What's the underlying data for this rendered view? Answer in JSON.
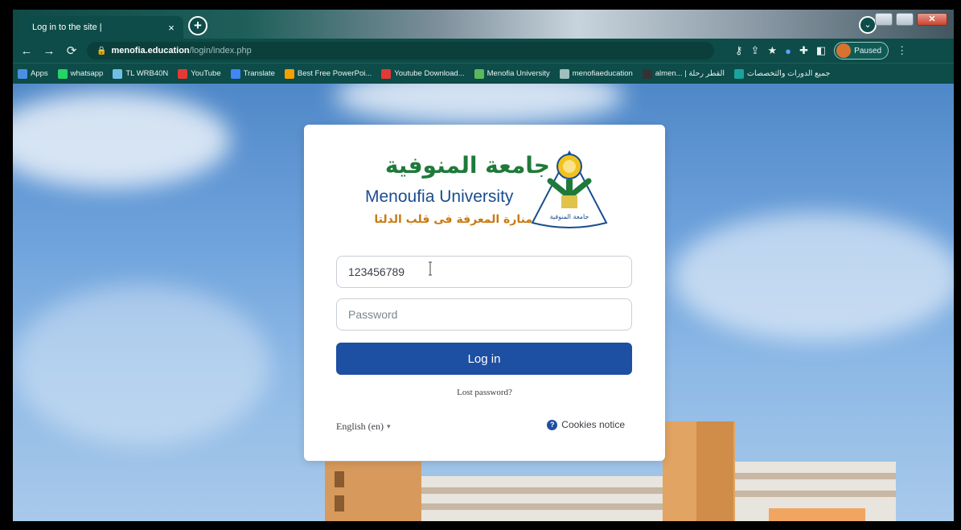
{
  "browser": {
    "tab_title": "Log in to the site |",
    "tab_close": "×",
    "new_tab": "+",
    "url_domain": "menofia.education",
    "url_path": "/login/index.php",
    "profile_label": "Paused",
    "bookmarks": [
      {
        "label": "Apps",
        "icon": "apps-grid-icon",
        "color": "#4a90e2"
      },
      {
        "label": "whatsapp",
        "icon": "whatsapp-icon",
        "color": "#25d366"
      },
      {
        "label": "TL WRB40N",
        "icon": "tplink-icon",
        "color": "#6ec1e4"
      },
      {
        "label": "YouTube",
        "icon": "youtube-icon",
        "color": "#e53935"
      },
      {
        "label": "Translate",
        "icon": "translate-icon",
        "color": "#4285f4"
      },
      {
        "label": "Best Free PowerPoi...",
        "icon": "powerpoint-icon",
        "color": "#f4a000"
      },
      {
        "label": "Youtube Download...",
        "icon": "youtube-download-icon",
        "color": "#e53935"
      },
      {
        "label": "Menofia University",
        "icon": "university-icon",
        "color": "#5cb85c"
      },
      {
        "label": "menofiaeducation",
        "icon": "globe-icon",
        "color": "#9fc0bd"
      },
      {
        "label": "almen... | القطر رحلة",
        "icon": "site-icon",
        "color": "#333333"
      },
      {
        "label": "جميع الدورات والتخصصات",
        "icon": "courses-icon",
        "color": "#1ba39c"
      }
    ]
  },
  "login": {
    "logo_arabic_name": "جامعة المنوفية",
    "logo_english_name": "Menoufia University",
    "logo_slogan": "منارة المعرفة فى قلب الدلتا",
    "emblem_text": "جامعة المنوفية",
    "username_value": "123456789",
    "password_placeholder": "Password",
    "login_button": "Log in",
    "lost_password": "Lost password?",
    "language": "English (en)",
    "cookies_notice": "Cookies notice"
  },
  "colors": {
    "browser_chrome": "#0d4c48",
    "primary_button": "#1d4fa3",
    "logo_green": "#1f7a3a",
    "logo_blue": "#1a4d8f",
    "logo_orange": "#c87a12"
  }
}
